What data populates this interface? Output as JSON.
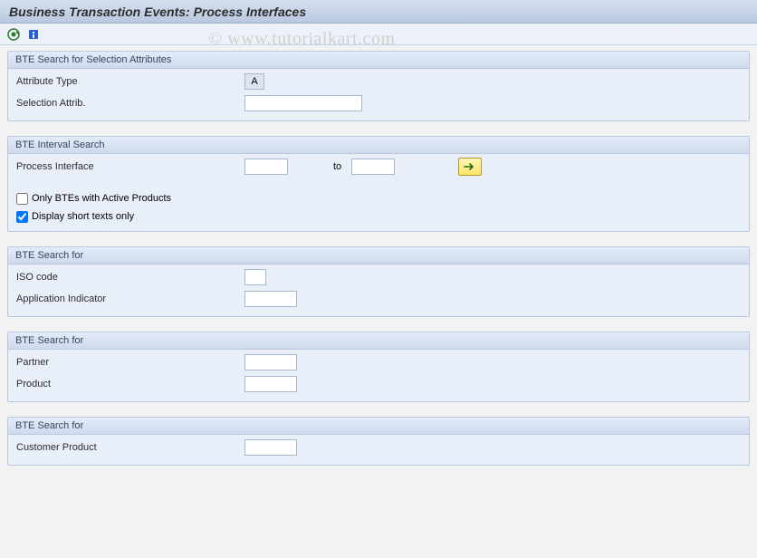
{
  "title": "Business Transaction Events: Process Interfaces",
  "watermark": "© www.tutorialkart.com",
  "group1": {
    "title": "BTE Search for Selection Attributes",
    "attr_type_label": "Attribute Type",
    "attr_type_value": "A",
    "sel_attrib_label": "Selection Attrib.",
    "sel_attrib_value": ""
  },
  "group2": {
    "title": "BTE Interval Search",
    "proc_if_label": "Process Interface",
    "proc_if_from": "",
    "to_label": "to",
    "proc_if_to": "",
    "chk_active_label": "Only BTEs with Active Products",
    "chk_active_checked": false,
    "chk_short_label": "Display short texts only",
    "chk_short_checked": true
  },
  "group3": {
    "title": "BTE Search for",
    "iso_label": "ISO code",
    "iso_value": "",
    "appind_label": "Application Indicator",
    "appind_value": ""
  },
  "group4": {
    "title": "BTE Search for",
    "partner_label": "Partner",
    "partner_value": "",
    "product_label": "Product",
    "product_value": ""
  },
  "group5": {
    "title": "BTE Search for",
    "cust_prod_label": "Customer Product",
    "cust_prod_value": ""
  }
}
